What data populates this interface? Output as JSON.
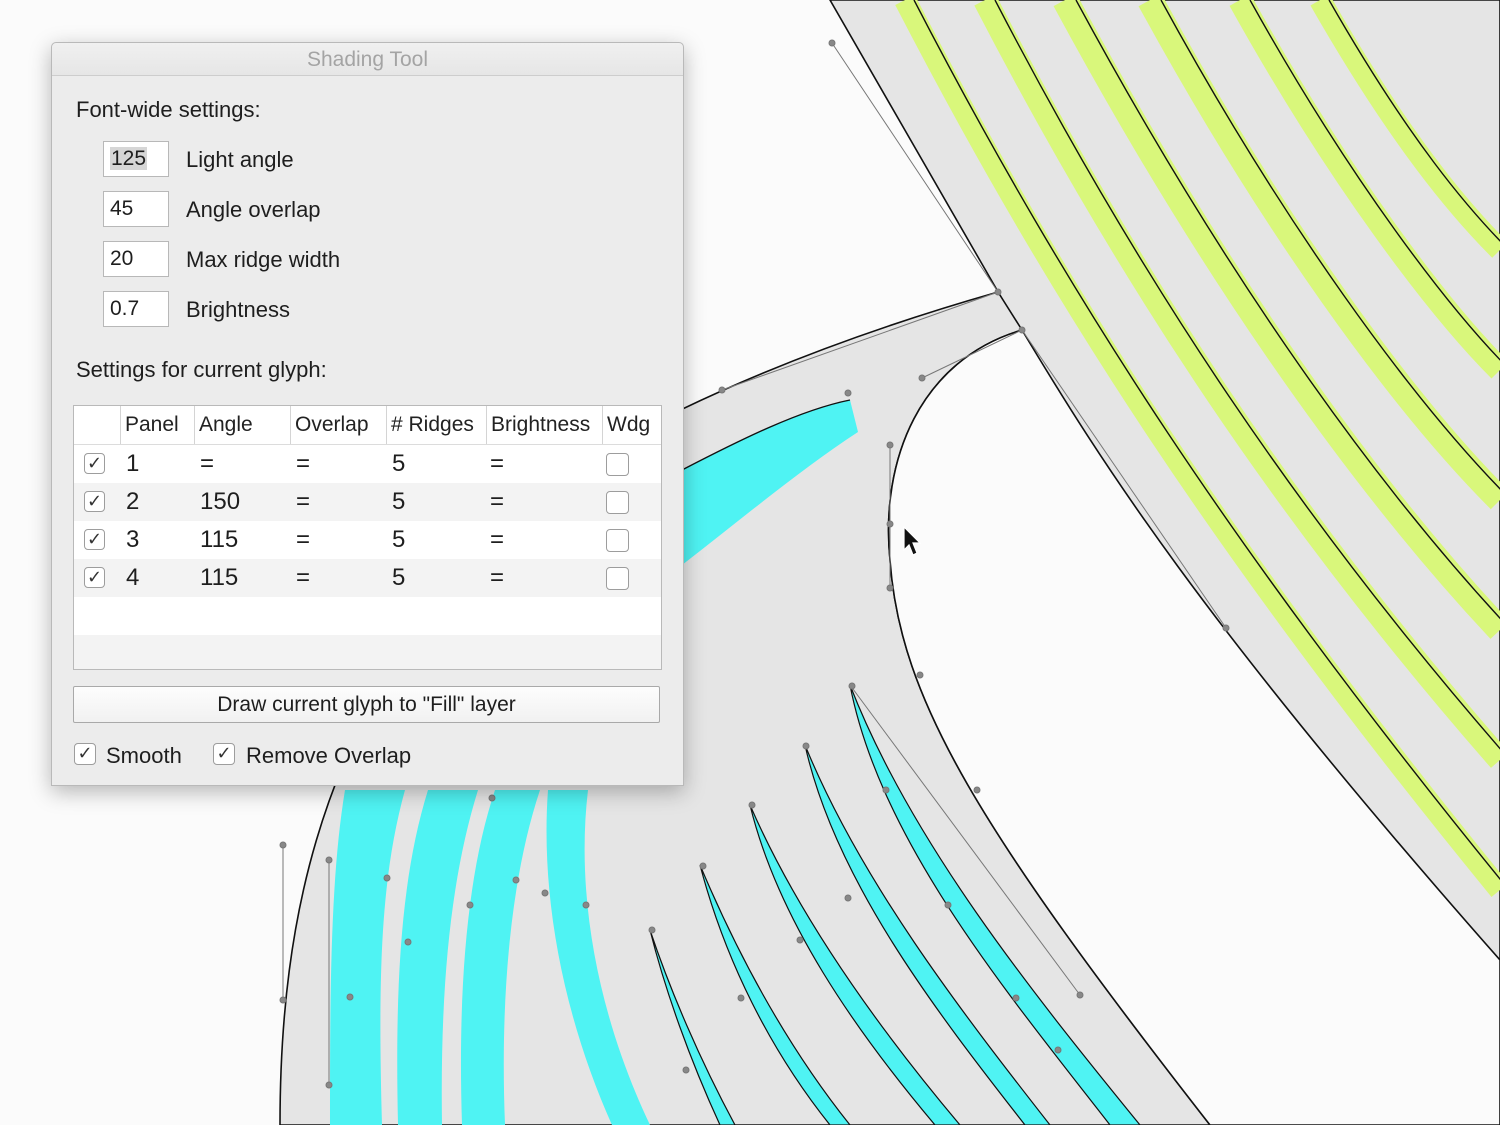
{
  "window": {
    "title": "Shading Tool"
  },
  "font_wide": {
    "heading": "Font-wide settings:",
    "fields": [
      {
        "value": "125",
        "label": "Light angle"
      },
      {
        "value": "45",
        "label": "Angle overlap"
      },
      {
        "value": "20",
        "label": "Max ridge width"
      },
      {
        "value": "0.7",
        "label": "Brightness"
      }
    ]
  },
  "glyph_settings": {
    "heading": "Settings for current glyph:",
    "columns": [
      "Panel",
      "Angle",
      "Overlap",
      "# Ridges",
      "Brightness",
      "Wdg"
    ],
    "rows": [
      {
        "checked": true,
        "panel": "1",
        "angle": "=",
        "overlap": "=",
        "ridges": "5",
        "brightness": "=",
        "wdg": false
      },
      {
        "checked": true,
        "panel": "2",
        "angle": "150",
        "overlap": "=",
        "ridges": "5",
        "brightness": "=",
        "wdg": false
      },
      {
        "checked": true,
        "panel": "3",
        "angle": "115",
        "overlap": "=",
        "ridges": "5",
        "brightness": "=",
        "wdg": false
      },
      {
        "checked": true,
        "panel": "4",
        "angle": "115",
        "overlap": "=",
        "ridges": "5",
        "brightness": "=",
        "wdg": false
      }
    ]
  },
  "actions": {
    "draw_button": "Draw current glyph to \"Fill\" layer",
    "smooth_label": "Smooth",
    "smooth_checked": true,
    "remove_overlap_label": "Remove Overlap",
    "remove_overlap_checked": true
  },
  "check_glyph": "✓",
  "colors": {
    "glyph_fill": "#e5e5e5",
    "lime_ridge": "#d9f77b",
    "cyan_ridge": "#4ff3f3",
    "canvas": "#fbfbfb"
  }
}
